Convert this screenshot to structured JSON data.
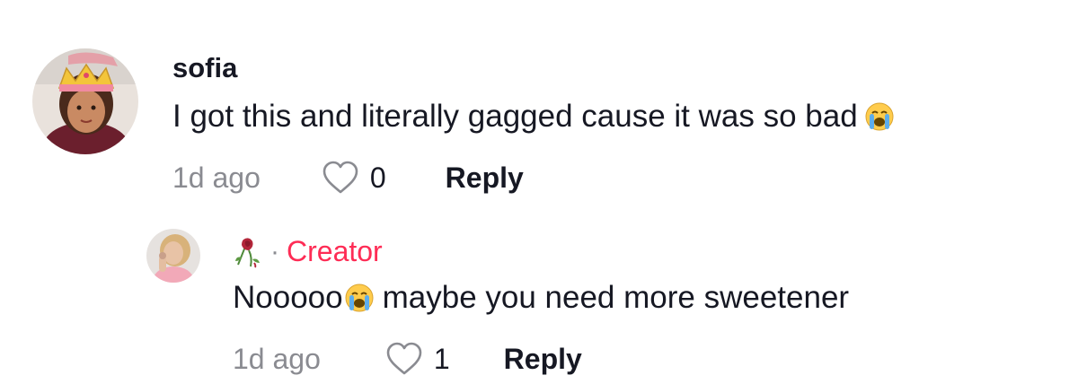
{
  "comment": {
    "username": "sofia",
    "text": "I got this and literally gagged cause it was so bad",
    "emoji": "loudly-crying-face",
    "time": "1d ago",
    "likes": "0",
    "reply_label": "Reply"
  },
  "reply": {
    "author_icon": "wilted-rose-icon",
    "separator": "·",
    "badge": "Creator",
    "text_before": "Nooooo",
    "emoji": "loudly-crying-face",
    "text_after": "maybe you need more sweetener",
    "time": "1d ago",
    "likes": "1",
    "reply_label": "Reply"
  },
  "colors": {
    "text": "#161823",
    "muted": "#8a8b91",
    "creator": "#fe2c55"
  }
}
